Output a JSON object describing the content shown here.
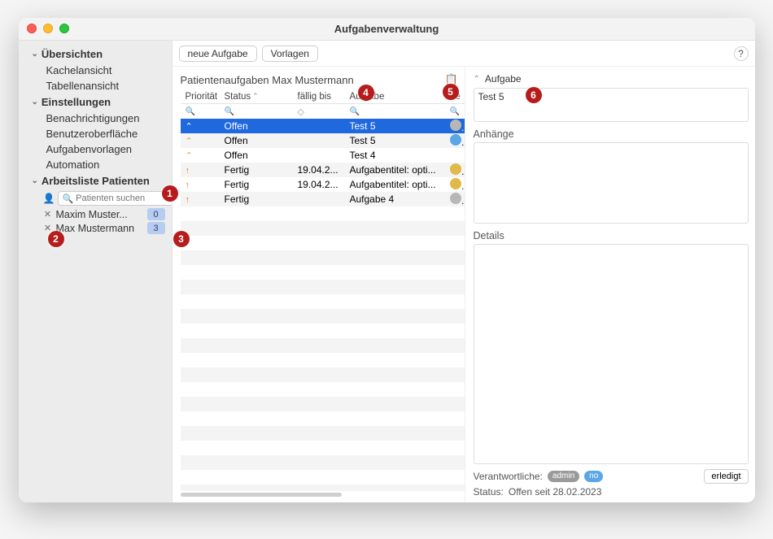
{
  "window": {
    "title": "Aufgabenverwaltung"
  },
  "toolbar": {
    "new": "neue Aufgabe",
    "templates": "Vorlagen",
    "help": "?"
  },
  "sidebar": {
    "sec1": "Übersichten",
    "sec1_items": {
      "tile": "Kachelansicht",
      "table": "Tabellenansicht"
    },
    "sec2": "Einstellungen",
    "sec2_items": {
      "notify": "Benachrichtigungen",
      "ui": "Benutzeroberfläche",
      "tmpl": "Aufgabenvorlagen",
      "auto": "Automation"
    },
    "sec3": "Arbeitsliste Patienten",
    "search_placeholder": "Patienten suchen",
    "patients": [
      {
        "name": "Maxim Muster...",
        "badge": "0"
      },
      {
        "name": "Max Mustermann",
        "badge": "3"
      }
    ]
  },
  "center": {
    "title": "Patientenaufgaben Max Mustermann",
    "cols": {
      "prio": "Priorität",
      "status": "Status",
      "due": "fällig bis",
      "task": "Aufgabe",
      "resp": "Ve"
    },
    "rows": [
      {
        "prio": "low",
        "status": "Offen",
        "due": "",
        "task": "Test 5",
        "sel": true,
        "av": "#b7b7b7"
      },
      {
        "prio": "low",
        "status": "Offen",
        "due": "",
        "task": "Test 5",
        "sel": false,
        "av": "#5aa6e6"
      },
      {
        "prio": "low",
        "status": "Offen",
        "due": "",
        "task": "Test 4",
        "sel": false,
        "av": ""
      },
      {
        "prio": "up",
        "status": "Fertig",
        "due": "19.04.2...",
        "task": "Aufgabentitel: opti...",
        "sel": false,
        "av": "#e0b94a"
      },
      {
        "prio": "up",
        "status": "Fertig",
        "due": "19.04.2...",
        "task": "Aufgabentitel: opti...",
        "sel": false,
        "av": "#e0b94a"
      },
      {
        "prio": "up",
        "status": "Fertig",
        "due": "",
        "task": "Aufgabe 4",
        "sel": false,
        "av": "#b7b7b7"
      }
    ]
  },
  "right": {
    "head": "Aufgabe",
    "title": "Test 5",
    "attachments_label": "Anhänge",
    "details_label": "Details",
    "resp_label": "Verantwortliche:",
    "resp_admin": "admin",
    "resp_no": "no",
    "status_label": "Status:",
    "status_value": "Offen seit 28.02.2023",
    "done": "erledigt"
  }
}
